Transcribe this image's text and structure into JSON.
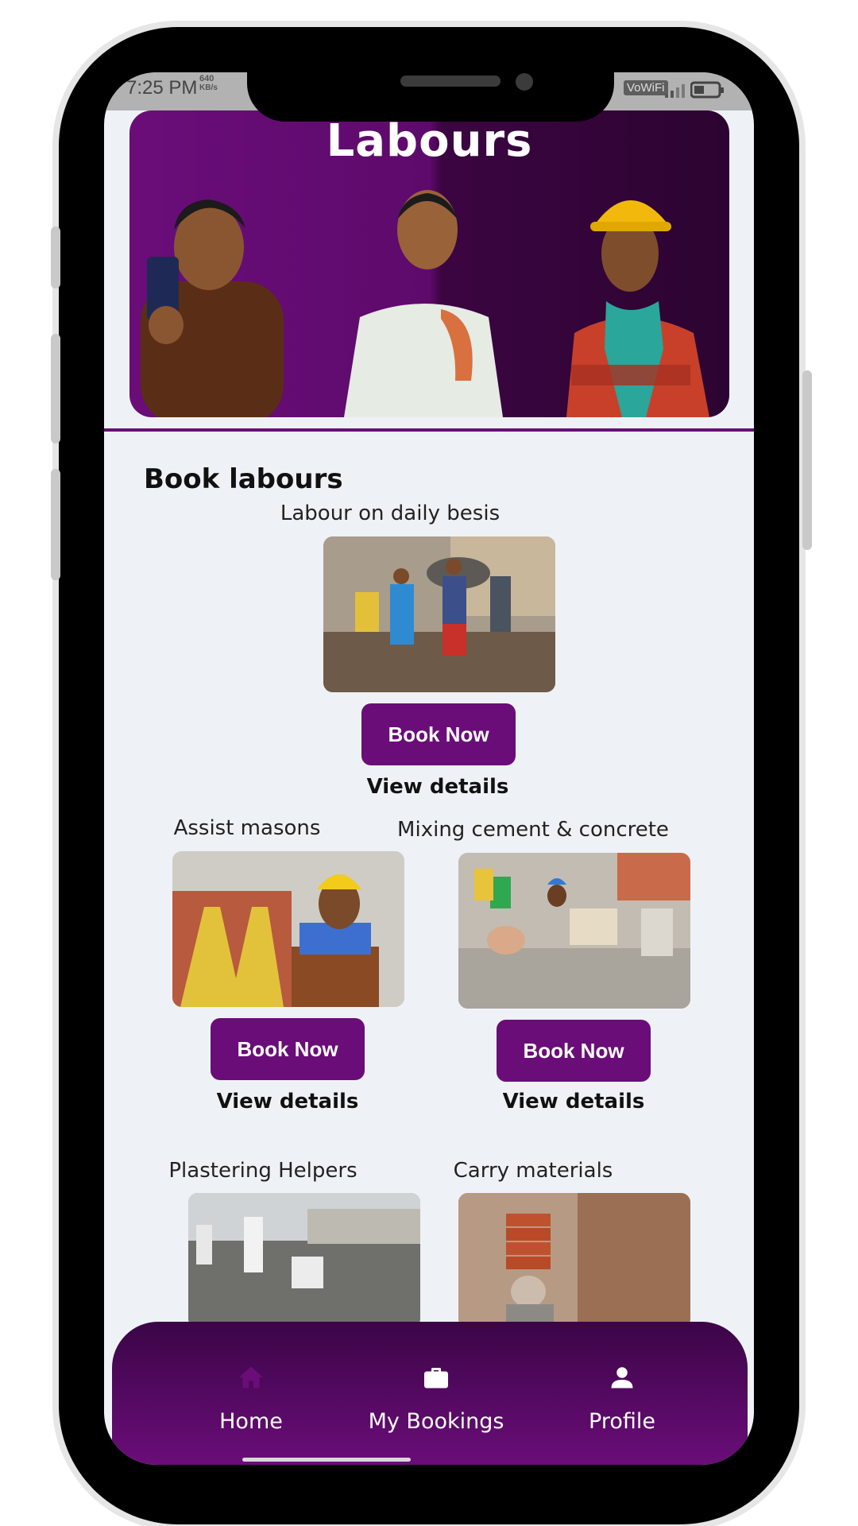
{
  "status_bar": {
    "time": "7:25 PM",
    "net_speed_value": "640",
    "net_speed_unit": "KB/s",
    "wifi_label": "VoWiFi"
  },
  "hero": {
    "title": "Labours"
  },
  "main": {
    "section_title": "Book labours",
    "cards": [
      {
        "label": "Labour on daily besis",
        "button": "Book Now",
        "details": "View details"
      },
      {
        "label": "Assist masons",
        "button": "Book Now",
        "details": "View details"
      },
      {
        "label": "Mixing cement & concrete",
        "button": "Book Now",
        "details": "View details"
      },
      {
        "label": "Plastering Helpers"
      },
      {
        "label": "Carry materials"
      }
    ]
  },
  "bottom_nav": {
    "items": [
      {
        "label": "Home",
        "icon": "home-icon",
        "active": true
      },
      {
        "label": "My Bookings",
        "icon": "briefcase-icon"
      },
      {
        "label": "Profile",
        "icon": "person-icon"
      }
    ]
  },
  "colors": {
    "primary": "#6a0d79",
    "nav_dark": "#3c0547",
    "background": "#eef2f7"
  }
}
